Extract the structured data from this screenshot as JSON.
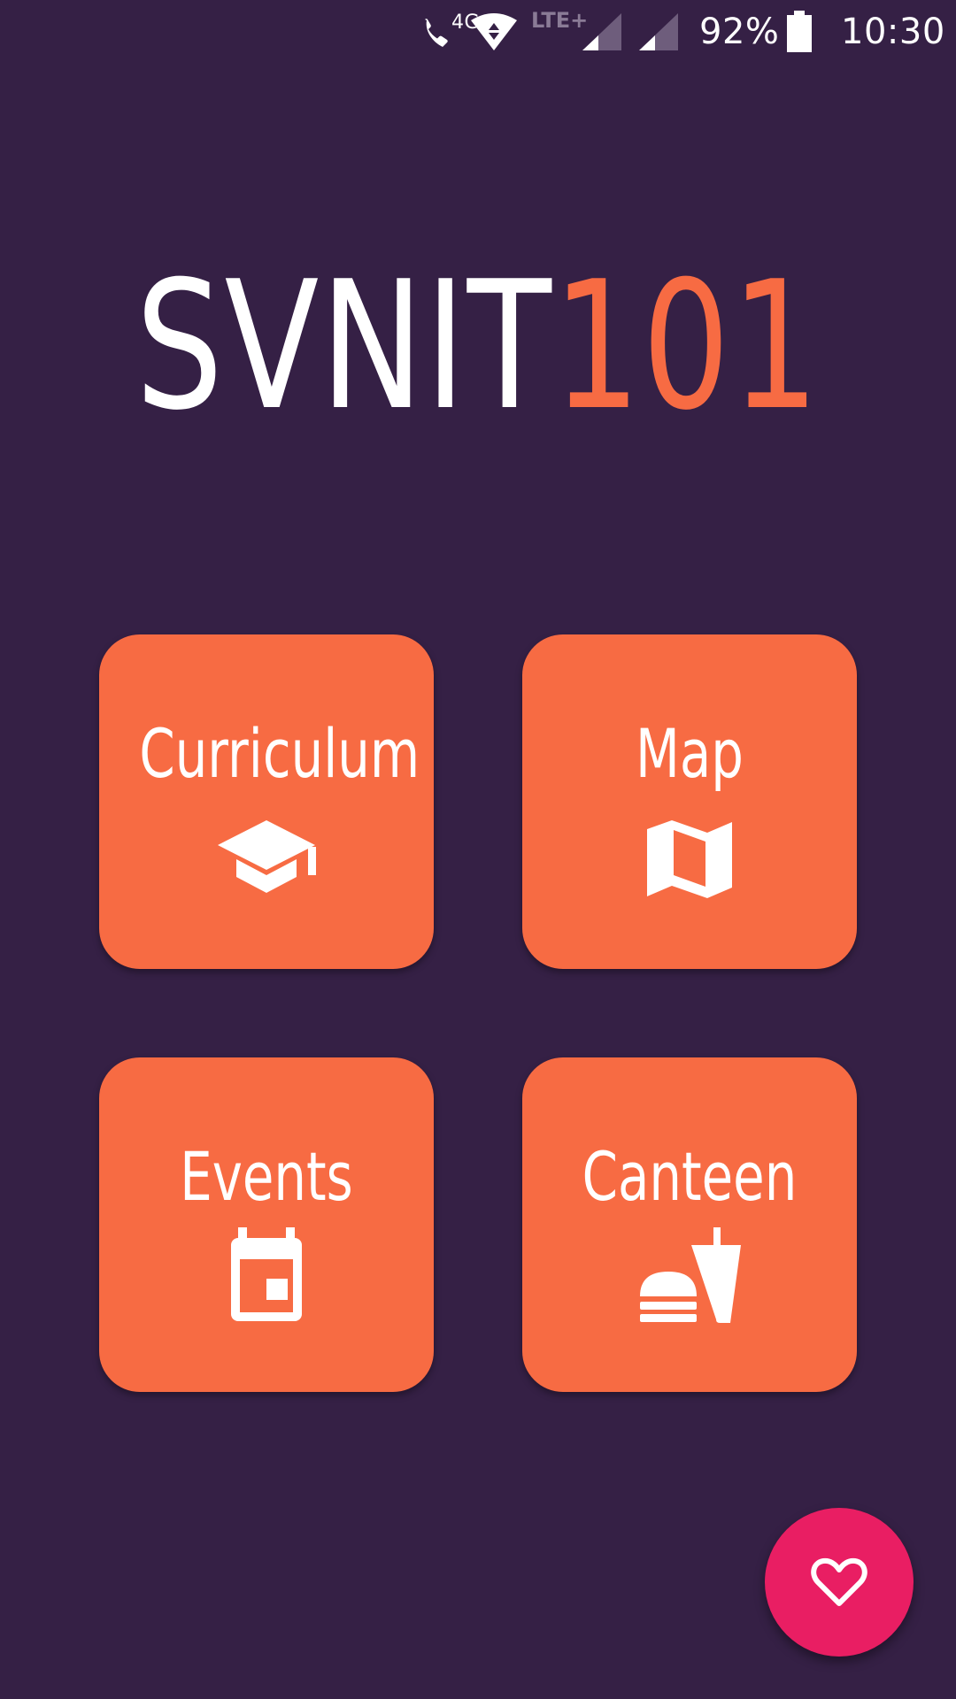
{
  "status_bar": {
    "call_badge": "4G",
    "network_type": "LTE+",
    "battery_percent": "92%",
    "battery_level": 0.92,
    "time": "10:30",
    "icons": [
      "call-4g-icon",
      "wifi-icon",
      "signal-icon",
      "signal-icon",
      "battery-icon"
    ]
  },
  "app": {
    "logo_primary": "SVNIT",
    "logo_accent": "101"
  },
  "tiles": [
    {
      "label": "Curriculum",
      "icon": "graduation-cap-icon"
    },
    {
      "label": "Map",
      "icon": "map-icon"
    },
    {
      "label": "Events",
      "icon": "calendar-event-icon"
    },
    {
      "label": "Canteen",
      "icon": "fastfood-icon"
    }
  ],
  "fab": {
    "icon": "heart-outline-icon"
  },
  "colors": {
    "background": "#352045",
    "tile": "#f76b43",
    "accent": "#f76b43",
    "fab": "#e91e63",
    "text": "#ffffff"
  }
}
